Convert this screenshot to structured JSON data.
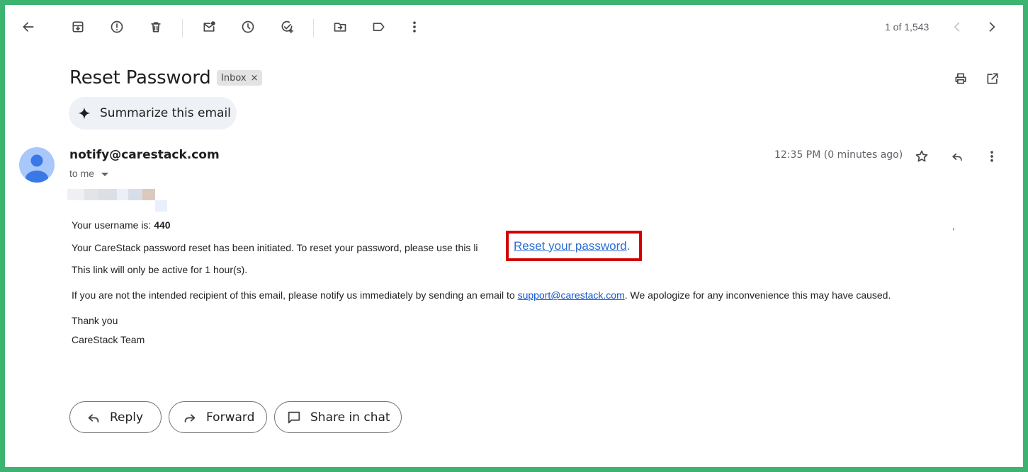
{
  "toolbar": {
    "back": "back-arrow-icon",
    "archive": "archive-icon",
    "spam": "report-spam-icon",
    "delete": "delete-icon",
    "mark_unread": "mark-unread-icon",
    "snooze": "snooze-icon",
    "add_task": "add-task-icon",
    "move_to": "move-to-icon",
    "labels": "label-icon",
    "more": "more-vert-icon",
    "counter": "1 of 1,543",
    "prev": "chevron-left-icon",
    "next": "chevron-right-icon"
  },
  "email": {
    "subject": "Reset Password",
    "label_chip": "Inbox",
    "label_chip_close": "×",
    "summarize_label": "Summarize this email",
    "sender": "notify@carestack.com",
    "recipient": "to me",
    "time": "12:35 PM (0 minutes ago)",
    "body": {
      "username_prefix": "Your username is: ",
      "username_value": "440",
      "reset_line": "Your CareStack password reset has been initiated. To reset your password, please use this li",
      "reset_link": "Reset your password",
      "reset_link_suffix": ".",
      "active_line": "This link will only be active for 1 hour(s).",
      "notify_prefix": "If you are not the intended recipient of this email, please notify us immediately by sending an email to ",
      "support_email": "support@carestack.com",
      "notify_suffix": ". We apologize for any inconvenience this may have caused.",
      "thanks": "Thank you",
      "signature": "CareStack Team",
      "stray_comma": ","
    }
  },
  "actions": {
    "reply": "Reply",
    "forward": "Forward",
    "share": "Share in chat"
  },
  "colors": {
    "frame": "#3cb371",
    "highlight": "#d40000",
    "link": "#1155cc"
  }
}
